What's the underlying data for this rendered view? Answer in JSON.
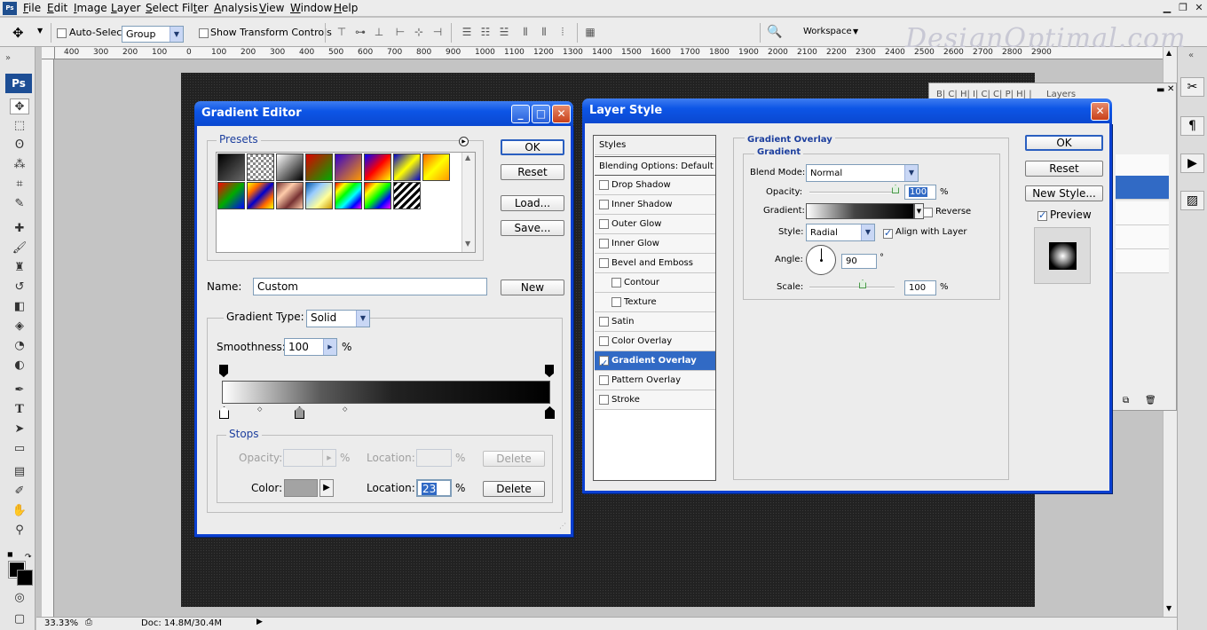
{
  "menubar": {
    "items": [
      {
        "label": "File",
        "u": "F"
      },
      {
        "label": "Edit",
        "u": "E"
      },
      {
        "label": "Image",
        "u": "I"
      },
      {
        "label": "Layer",
        "u": "L"
      },
      {
        "label": "Select",
        "u": "S"
      },
      {
        "label": "Filter",
        "u": "T"
      },
      {
        "label": "Analysis",
        "u": "A"
      },
      {
        "label": "View",
        "u": "V"
      },
      {
        "label": "Window",
        "u": "W"
      },
      {
        "label": "Help",
        "u": "H"
      }
    ],
    "app_logo": "Ps"
  },
  "options": {
    "auto_select_label": "Auto-Select:",
    "auto_select_value": "Group",
    "show_transform_label": "Show Transform Controls",
    "workspace_label": "Workspace",
    "watermark": "DesignOptimal.com"
  },
  "ruler": {
    "ticks": [
      "400",
      "300",
      "200",
      "100",
      "0",
      "100",
      "200",
      "300",
      "400",
      "500",
      "600",
      "700",
      "800",
      "900",
      "1000",
      "1100",
      "1200",
      "1300",
      "1400",
      "1500",
      "1600",
      "1700",
      "1800",
      "1900",
      "2000",
      "2100",
      "2200",
      "2300",
      "2400",
      "2500",
      "2600",
      "2700",
      "2800",
      "2900"
    ]
  },
  "status": {
    "zoom": "33.33%",
    "doc": "Doc: 14.8M/30.4M"
  },
  "toolbox": {
    "logo": "Ps"
  },
  "gradient_editor": {
    "title": "Gradient Editor",
    "presets_label": "Presets",
    "ok": "OK",
    "reset": "Reset",
    "load": "Load...",
    "save": "Save...",
    "name_label": "Name:",
    "name_value": "Custom",
    "new": "New",
    "gradient_type_label": "Gradient Type:",
    "gradient_type_value": "Solid",
    "smoothness_label": "Smoothness:",
    "smoothness_value": "100",
    "percent": "%",
    "stops_label": "Stops",
    "opacity_label": "Opacity:",
    "location_label": "Location:",
    "delete": "Delete",
    "color_label": "Color:",
    "color_location_value": "23"
  },
  "layer_style": {
    "title": "Layer Style",
    "styles_header": "Styles",
    "blending": "Blending Options: Default",
    "items": [
      {
        "label": "Drop Shadow",
        "checked": false,
        "indent": false
      },
      {
        "label": "Inner Shadow",
        "checked": false,
        "indent": false
      },
      {
        "label": "Outer Glow",
        "checked": false,
        "indent": false
      },
      {
        "label": "Inner Glow",
        "checked": false,
        "indent": false
      },
      {
        "label": "Bevel and Emboss",
        "checked": false,
        "indent": false
      },
      {
        "label": "Contour",
        "checked": false,
        "indent": true
      },
      {
        "label": "Texture",
        "checked": false,
        "indent": true
      },
      {
        "label": "Satin",
        "checked": false,
        "indent": false
      },
      {
        "label": "Color Overlay",
        "checked": false,
        "indent": false
      },
      {
        "label": "Gradient Overlay",
        "checked": true,
        "indent": false,
        "active": true
      },
      {
        "label": "Pattern Overlay",
        "checked": false,
        "indent": false
      },
      {
        "label": "Stroke",
        "checked": false,
        "indent": false
      }
    ],
    "section_title": "Gradient Overlay",
    "subsection_title": "Gradient",
    "blend_mode_label": "Blend Mode:",
    "blend_mode_value": "Normal",
    "opacity_label": "Opacity:",
    "opacity_value": "100",
    "percent": "%",
    "gradient_label": "Gradient:",
    "reverse_label": "Reverse",
    "style_label": "Style:",
    "style_value": "Radial",
    "align_label": "Align with Layer",
    "angle_label": "Angle:",
    "angle_value": "90",
    "degree": "°",
    "scale_label": "Scale:",
    "scale_value": "100",
    "ok": "OK",
    "reset": "Reset",
    "new_style": "New Style...",
    "preview_label": "Preview"
  },
  "layers_panel": {
    "tab": "Layers"
  },
  "colors": {
    "accent": "#316ac5",
    "xp_title": "#0a48d0"
  }
}
